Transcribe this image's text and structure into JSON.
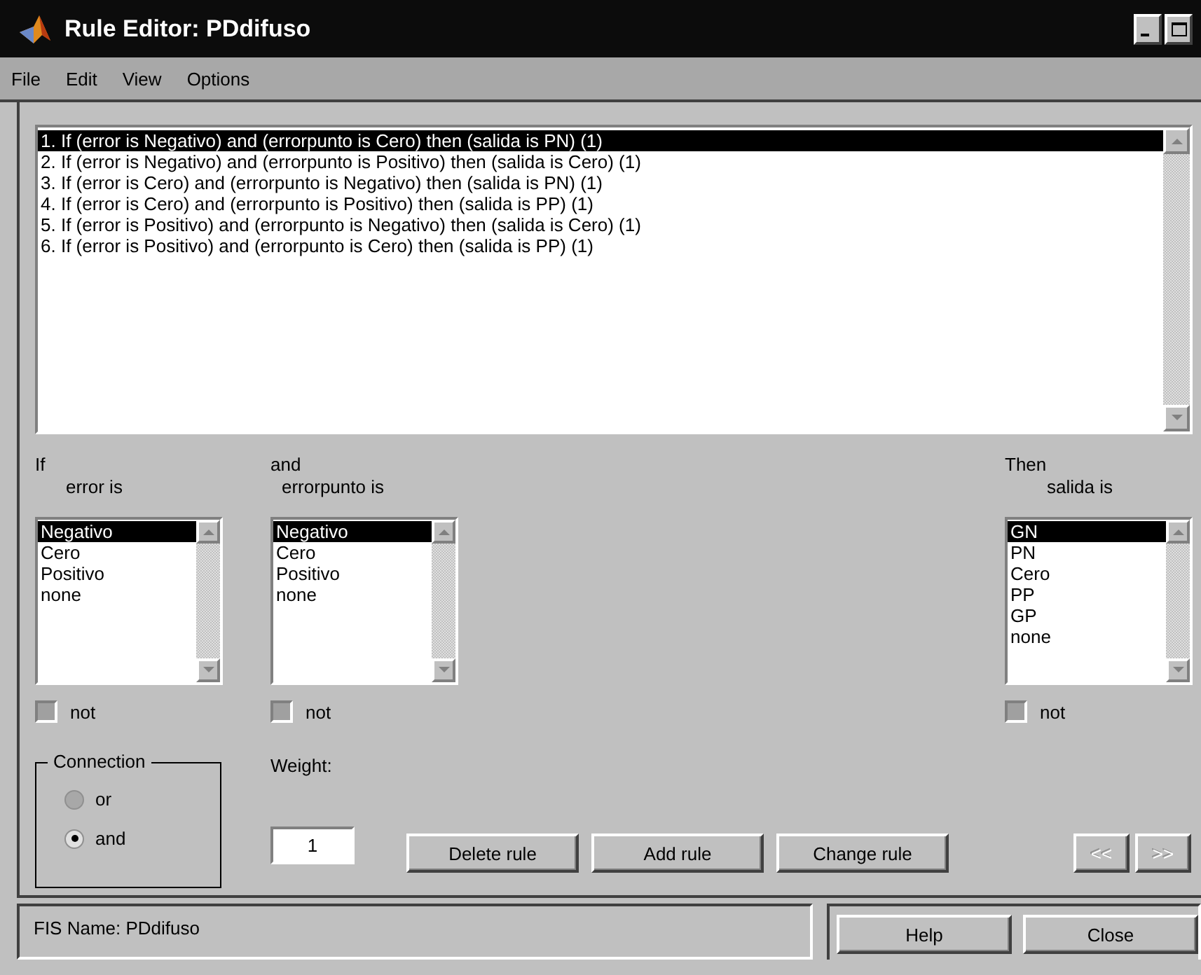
{
  "window": {
    "title": "Rule Editor: PDdifuso"
  },
  "menu": [
    "File",
    "Edit",
    "View",
    "Options"
  ],
  "rules": [
    {
      "text": "1. If (error is Negativo) and (errorpunto is Cero) then (salida is PN) (1)",
      "selected": true
    },
    {
      "text": "2. If (error is Negativo) and (errorpunto is Positivo) then (salida is Cero) (1)",
      "selected": false
    },
    {
      "text": "3. If (error is Cero) and (errorpunto is Negativo) then (salida is PN) (1)",
      "selected": false
    },
    {
      "text": "4. If (error is Cero) and (errorpunto is Positivo) then (salida is PP) (1)",
      "selected": false
    },
    {
      "text": "5. If (error is Positivo) and (errorpunto is Negativo) then (salida is Cero) (1)",
      "selected": false
    },
    {
      "text": "6. If (error is Positivo) and (errorpunto is Cero) then (salida is PP) (1)",
      "selected": false
    }
  ],
  "variables": [
    {
      "header": "If",
      "label": "error is",
      "items": [
        {
          "text": "Negativo",
          "selected": true
        },
        {
          "text": "Cero",
          "selected": false
        },
        {
          "text": "Positivo",
          "selected": false
        },
        {
          "text": "none",
          "selected": false
        }
      ],
      "not": {
        "label": "not",
        "checked": false
      }
    },
    {
      "header": "and",
      "label": "errorpunto is",
      "items": [
        {
          "text": "Negativo",
          "selected": true
        },
        {
          "text": "Cero",
          "selected": false
        },
        {
          "text": "Positivo",
          "selected": false
        },
        {
          "text": "none",
          "selected": false
        }
      ],
      "not": {
        "label": "not",
        "checked": false
      }
    },
    {
      "header": "Then",
      "label": "salida is",
      "items": [
        {
          "text": "GN",
          "selected": true
        },
        {
          "text": "PN",
          "selected": false
        },
        {
          "text": "Cero",
          "selected": false
        },
        {
          "text": "PP",
          "selected": false
        },
        {
          "text": "GP",
          "selected": false
        },
        {
          "text": "none",
          "selected": false
        }
      ],
      "not": {
        "label": "not",
        "checked": false
      }
    }
  ],
  "connection": {
    "title": "Connection",
    "options": [
      {
        "label": "or",
        "selected": false
      },
      {
        "label": "and",
        "selected": true
      }
    ]
  },
  "weight": {
    "label": "Weight:",
    "value": "1"
  },
  "rule_buttons": [
    "Delete rule",
    "Add rule",
    "Change rule"
  ],
  "nav_buttons": [
    {
      "label": "<<",
      "disabled": true
    },
    {
      "label": ">>",
      "disabled": true
    }
  ],
  "status": "FIS Name: PDdifuso",
  "bottom_buttons": [
    "Help",
    "Close"
  ]
}
